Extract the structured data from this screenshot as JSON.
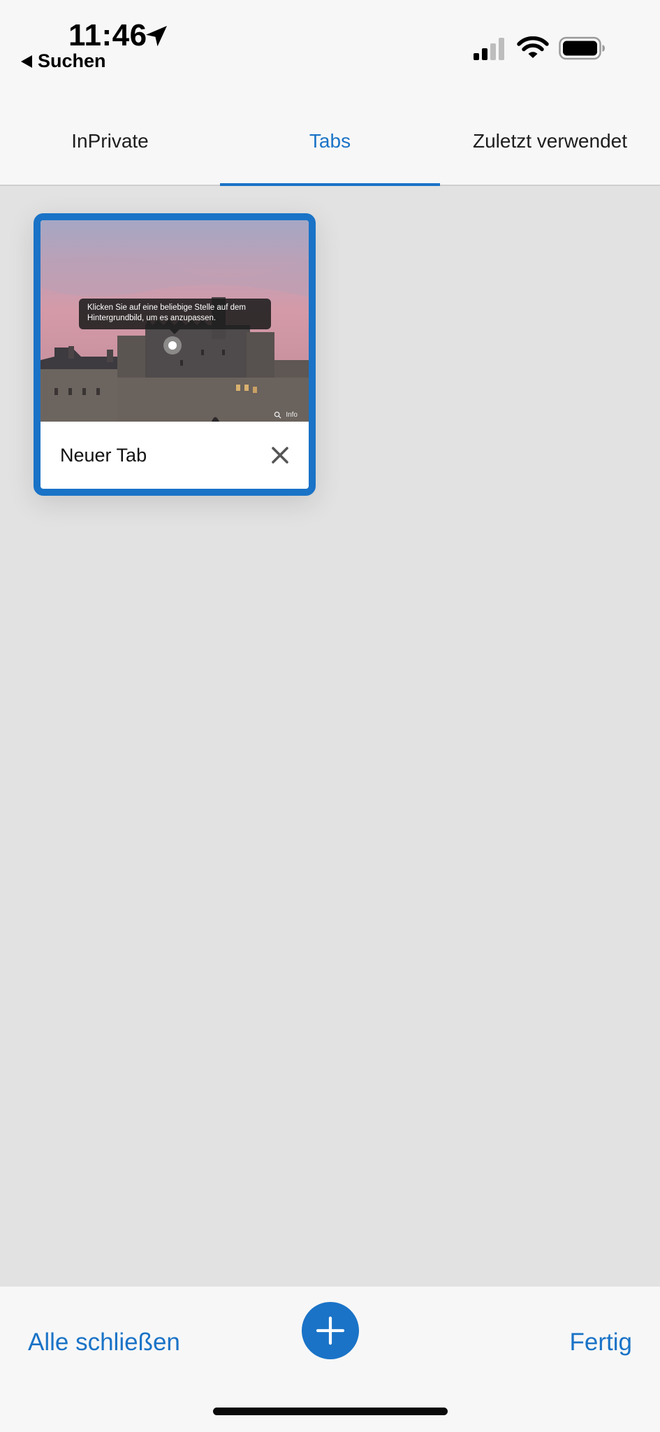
{
  "status_bar": {
    "time": "11:46",
    "back_label": "Suchen",
    "icons": [
      "location-arrow-icon",
      "cellular-signal-icon",
      "wifi-icon",
      "battery-icon"
    ]
  },
  "tabs": [
    {
      "label": "InPrivate",
      "active": false
    },
    {
      "label": "Tabs",
      "active": true
    },
    {
      "label": "Zuletzt verwendet",
      "active": false
    }
  ],
  "tab_card": {
    "title": "Neuer Tab",
    "tooltip": "Klicken Sie auf eine beliebige Stelle auf dem Hintergrundbild, um es anzupassen.",
    "info_label": "Info",
    "close_icon": "close-icon"
  },
  "toolbar": {
    "close_all_label": "Alle schließen",
    "add_icon": "plus-icon",
    "done_label": "Fertig"
  },
  "colors": {
    "accent": "#1a73c7",
    "bar_background": "#f7f7f7",
    "content_background": "#e2e2e2"
  }
}
